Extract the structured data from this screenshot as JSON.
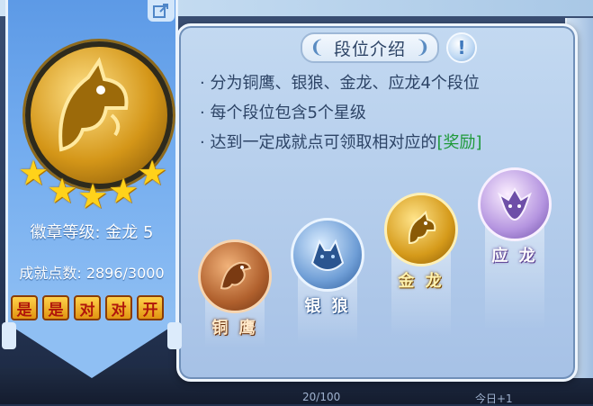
{
  "header": {
    "title": "段位介绍",
    "info_icon": "!"
  },
  "rules": [
    "分为铜鹰、银狼、金龙、应龙4个段位",
    "每个段位包含5个星级",
    "达到一定成就点可领取相对应的"
  ],
  "reward_link": "[奖励]",
  "bullet": "·",
  "ranks": [
    {
      "name": "铜 鹰",
      "label_color": "#ffe9c9",
      "stroke": "#6a2f08",
      "icon": "eagle-icon"
    },
    {
      "name": "银 狼",
      "label_color": "#ffffff",
      "stroke": "#244d86",
      "icon": "wolf-icon"
    },
    {
      "name": "金 龙",
      "label_color": "#fff3b0",
      "stroke": "#7a4a03",
      "icon": "dragon-icon"
    },
    {
      "name": "应 龙",
      "label_color": "#ffffff",
      "stroke": "#5b3f91",
      "icon": "purple-dragon-icon"
    }
  ],
  "card": {
    "badge_level": "徽章等级: 金龙 5",
    "achievement": "成就点数: 2896/3000",
    "stars_filled": 5,
    "buttons": [
      "是",
      "是",
      "对",
      "对",
      "开"
    ],
    "share_icon": "share-icon",
    "star_glyph": "★"
  },
  "bottom": {
    "progress_text": "20/100",
    "today_text": "今日+1"
  },
  "colors": {
    "accent_green": "#1f9a3a",
    "text_dark": "#2d4466",
    "gold": "#d59a1a"
  }
}
